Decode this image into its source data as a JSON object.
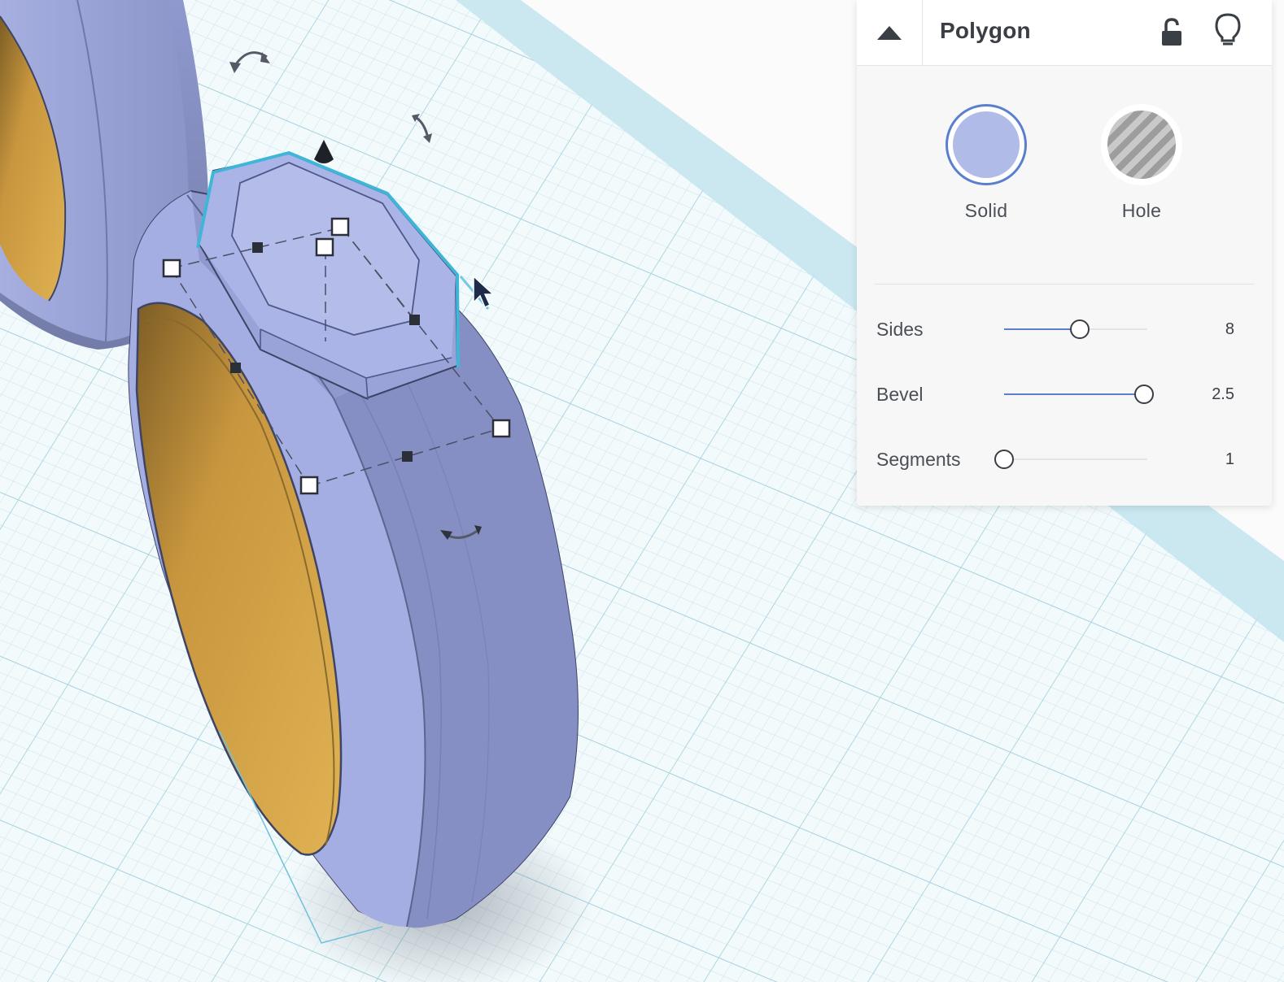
{
  "panel": {
    "title": "Polygon",
    "collapse_icon": "caret-up-icon",
    "lock_icon": "unlock-icon",
    "hint_icon": "lightbulb-icon",
    "materials": [
      {
        "label": "Solid",
        "color": "#b0bbe8",
        "selected": true
      },
      {
        "label": "Hole",
        "color": "#b5b5b5",
        "selected": false
      }
    ],
    "params": [
      {
        "label": "Sides",
        "value": "8",
        "fraction": 0.53
      },
      {
        "label": "Bevel",
        "value": "2.5",
        "fraction": 0.98
      },
      {
        "label": "Segments",
        "value": "1",
        "fraction": 0.0
      }
    ]
  },
  "viewport": {
    "shape_color": "#a7b1e4",
    "hole_color": "#d6a647",
    "selection_color": "#3fb6d8",
    "grid_color": "#bfe0ea"
  }
}
